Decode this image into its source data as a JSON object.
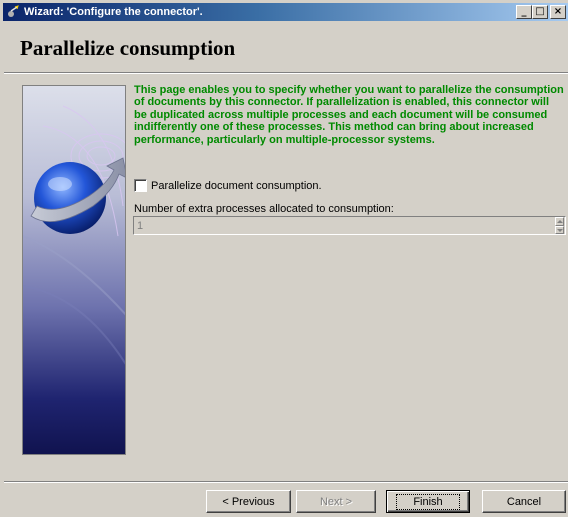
{
  "window": {
    "title": "Wizard: 'Configure the connector'.",
    "minimize": "_",
    "maximize": "□",
    "close": "×"
  },
  "page": {
    "title": "Parallelize consumption",
    "description": "This page enables you to specify whether you want to parallelize the consumption of documents by this connector. If parallelization is enabled, this connector will be duplicated across  multiple processes and each document will be consumed indifferently one of these processes. This method can bring about increased performance, particularly on multiple-processor systems."
  },
  "options": {
    "parallelize_label": "Parallelize document consumption.",
    "parallelize_checked": false,
    "extra_processes_label": "Number of extra processes allocated to consumption:",
    "extra_processes_value": "1"
  },
  "buttons": {
    "previous": "< Previous",
    "next": "Next >",
    "finish": "Finish",
    "cancel": "Cancel"
  },
  "colors": {
    "description_text": "#008a00",
    "title_bar_start": "#0a246a",
    "title_bar_end": "#a6caf0",
    "window_bg": "#d4d0c8"
  },
  "icons": {
    "side_image": "globe-with-arrow",
    "title_icon": "wizard-icon"
  }
}
